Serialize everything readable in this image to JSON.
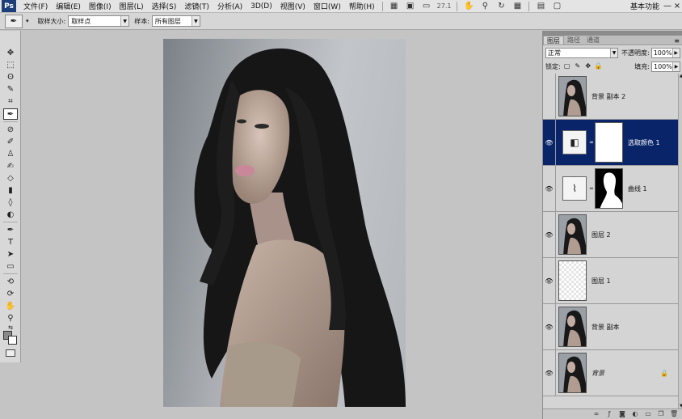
{
  "app": {
    "logo_text": "Ps"
  },
  "menubar": {
    "items": [
      "文件(F)",
      "编辑(E)",
      "图像(I)",
      "图层(L)",
      "选择(S)",
      "滤镜(T)",
      "分析(A)",
      "3D(D)",
      "视图(V)",
      "窗口(W)",
      "帮助(H)"
    ],
    "zoom": "27.1",
    "workspace": "基本功能",
    "minimize": "—",
    "close": "×"
  },
  "options": {
    "sample_size_label": "取样大小:",
    "sample_size_value": "取样点",
    "sample_label": "样本:",
    "sample_value": "所有图层"
  },
  "layers_panel": {
    "tabs": [
      "图层",
      "路径",
      "通道"
    ],
    "blend_mode": "正常",
    "opacity_label": "不透明度:",
    "opacity": "100%",
    "lock_label": "锁定:",
    "fill_label": "填充:",
    "fill": "100%",
    "layers": [
      {
        "name": "背景 副本 2",
        "visible": false,
        "kind": "pixel",
        "selected": false,
        "italic": false
      },
      {
        "name": "选取颜色 1",
        "visible": true,
        "kind": "selective-color",
        "selected": true,
        "italic": false
      },
      {
        "name": "曲线 1",
        "visible": true,
        "kind": "curves",
        "selected": false,
        "italic": false
      },
      {
        "name": "图层 2",
        "visible": true,
        "kind": "pixel",
        "selected": false,
        "italic": false
      },
      {
        "name": "图层 1",
        "visible": true,
        "kind": "transparent",
        "selected": false,
        "italic": false
      },
      {
        "name": "背景 副本",
        "visible": true,
        "kind": "pixel",
        "selected": false,
        "italic": false
      },
      {
        "name": "背景",
        "visible": true,
        "kind": "pixel",
        "selected": false,
        "italic": true,
        "locked": true
      }
    ]
  },
  "colors": {
    "selection": "#0a246a",
    "foreground": "#8a8a8a",
    "background": "#ffffff"
  }
}
